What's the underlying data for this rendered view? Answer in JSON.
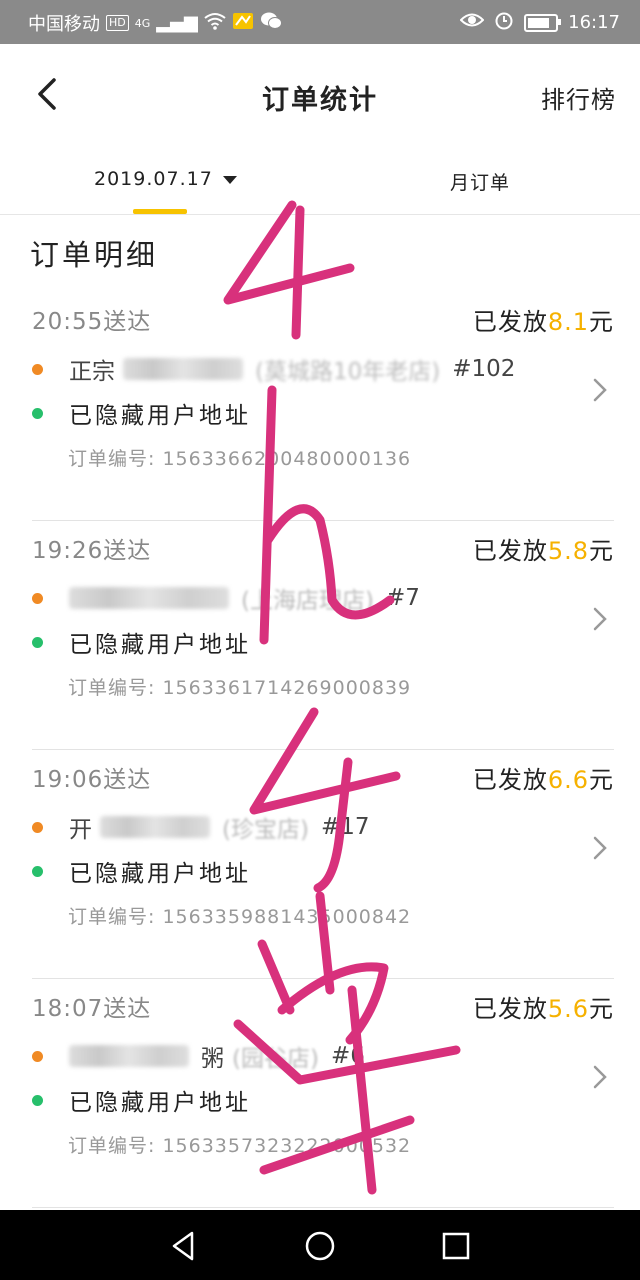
{
  "status_bar": {
    "carrier": "中国移动",
    "hd": "HD",
    "network": "4G",
    "time": "16:17"
  },
  "header": {
    "title": "订单统计",
    "right_label": "排行榜"
  },
  "tabs": {
    "date": "2019.07.17",
    "month": "月订单"
  },
  "section_title": "订单明细",
  "colors": {
    "accent_yellow": "#f7c300",
    "amount_orange": "#f6b100",
    "dot_orange": "#f08a24",
    "dot_green": "#27bf6b",
    "handwriting": "#d8317c"
  },
  "orders": [
    {
      "time": "20:55送达",
      "status_prefix": "已发放",
      "amount": "8.1",
      "unit": "元",
      "shop_visible": "正宗",
      "shop_tail": "(莫城路10年老店)",
      "shop_number": "#102",
      "address": "已隐藏用户地址",
      "order_label": "订单编号:",
      "order_no": "1563366200480000136"
    },
    {
      "time": "19:26送达",
      "status_prefix": "已发放",
      "amount": "5.8",
      "unit": "元",
      "shop_visible": "",
      "shop_tail": "(上海店理店)",
      "shop_number": "#7",
      "address": "已隐藏用户地址",
      "order_label": "订单编号:",
      "order_no": "1563361714269000839"
    },
    {
      "time": "19:06送达",
      "status_prefix": "已发放",
      "amount": "6.6",
      "unit": "元",
      "shop_visible": "开",
      "shop_tail": "(珍宝店)",
      "shop_number": "#17",
      "address": "已隐藏用户地址",
      "order_label": "订单编号:",
      "order_no": "1563359881435000842"
    },
    {
      "time": "18:07送达",
      "status_prefix": "已发放",
      "amount": "5.6",
      "unit": "元",
      "shop_visible": "粥",
      "shop_tail": "(园谷店)",
      "shop_number": "#6",
      "address": "已隐藏用户地址",
      "order_label": "订单编号:",
      "order_no": "1563357323222000532"
    }
  ]
}
